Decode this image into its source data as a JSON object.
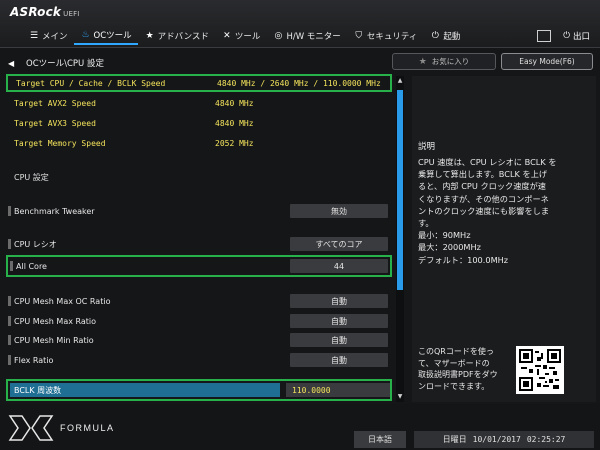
{
  "brand": {
    "name": "ASRock",
    "suffix": "UEFI"
  },
  "tabs": [
    {
      "label": "メイン",
      "icon": "list-icon"
    },
    {
      "label": "OCツール",
      "icon": "flame-icon",
      "active": true
    },
    {
      "label": "アドバンスド",
      "icon": "star-icon"
    },
    {
      "label": "ツール",
      "icon": "tools-icon"
    },
    {
      "label": "H/W モニター",
      "icon": "monitor-icon"
    },
    {
      "label": "セキュリティ",
      "icon": "shield-icon"
    },
    {
      "label": "起動",
      "icon": "power-icon"
    }
  ],
  "exit_label": "出口",
  "breadcrumb": "OCツール\\CPU 設定",
  "favorites_label": "お気に入り",
  "easy_mode_label": "Easy Mode(F6)",
  "info_rows": [
    {
      "label": "Target CPU / Cache / BCLK Speed",
      "value": "4840 MHz / 2640 MHz / 110.0000 MHz"
    },
    {
      "label": "Target AVX2 Speed",
      "value": "4840 MHz"
    },
    {
      "label": "Target AVX3 Speed",
      "value": "4840 MHz"
    },
    {
      "label": "Target Memory Speed",
      "value": "2052 MHz"
    }
  ],
  "section_title": "CPU 設定",
  "settings": {
    "benchmark": {
      "label": "Benchmark Tweaker",
      "value": "無効"
    },
    "ratio": {
      "label": "CPU レシオ",
      "value": "すべてのコア"
    },
    "all_core": {
      "label": "All Core",
      "value": "44"
    },
    "mesh_max_oc": {
      "label": "CPU Mesh Max OC Ratio",
      "value": "自動"
    },
    "mesh_max": {
      "label": "CPU Mesh Max Ratio",
      "value": "自動"
    },
    "mesh_min": {
      "label": "CPU Mesh Min Ratio",
      "value": "自動"
    },
    "flex": {
      "label": "Flex Ratio",
      "value": "自動"
    },
    "bclk": {
      "label": "BCLK 周波数",
      "value": "110.0000"
    }
  },
  "description": {
    "title": "説明",
    "lines": [
      "CPU 速度は、CPU レシオに BCLK を",
      "乗算して算出します。BCLK を上げ",
      "ると、内部 CPU クロック速度が速",
      "くなりますが、その他のコンポーネ",
      "ントのクロック速度にも影響をしま",
      "す。",
      "最小：90MHz",
      "最大：2000MHz",
      "デフォルト：100.0MHz"
    ],
    "qr_lines": [
      "このQRコードを使っ",
      "て、マザーボードの",
      "取扱説明書PDFをダウ",
      "ンロードできます。"
    ]
  },
  "footer": {
    "logo_text": "FORMULA",
    "language": "日本語",
    "day": "日曜日",
    "date": "10/01/2017",
    "time": "02:25:27"
  }
}
